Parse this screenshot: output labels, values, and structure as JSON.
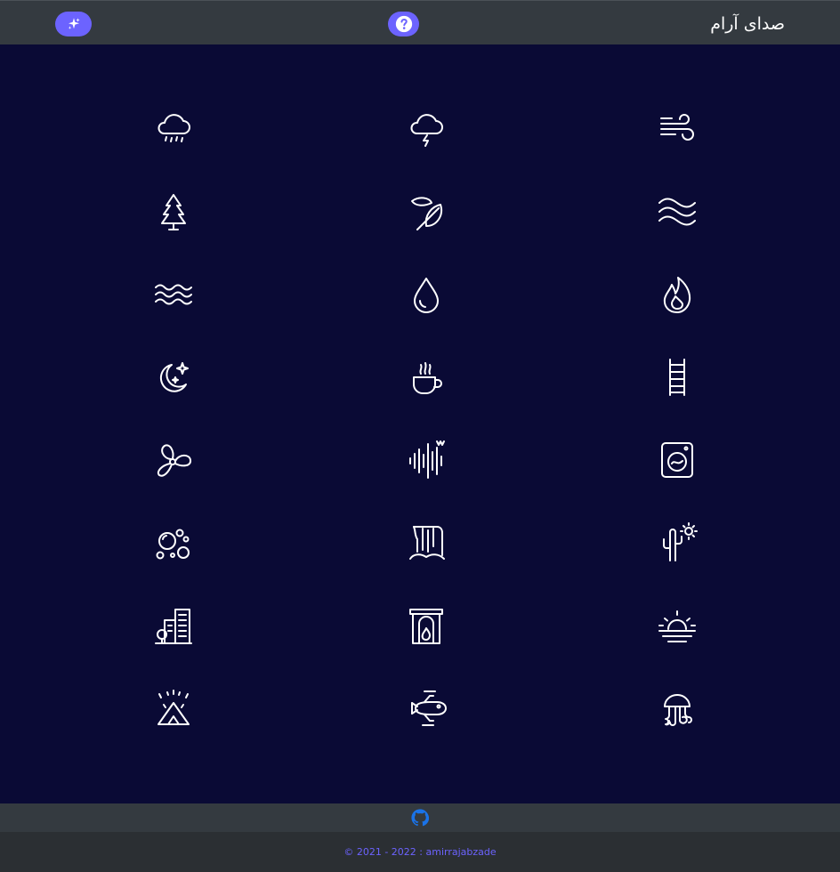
{
  "header": {
    "title": "صدای آرام",
    "theme_button_icon": "sparkles-icon",
    "help_button_icon": "question-circle-icon",
    "accent_color": "#6c63ff",
    "bar_color": "#343a40"
  },
  "sounds": [
    {
      "icon": "rain-cloud-icon"
    },
    {
      "icon": "thunderstorm-icon"
    },
    {
      "icon": "wind-icon"
    },
    {
      "icon": "pine-tree-icon"
    },
    {
      "icon": "leaves-icon"
    },
    {
      "icon": "waves-icon"
    },
    {
      "icon": "sea-waves-icon"
    },
    {
      "icon": "water-drop-icon"
    },
    {
      "icon": "fire-icon"
    },
    {
      "icon": "moon-stars-icon"
    },
    {
      "icon": "coffee-cup-icon"
    },
    {
      "icon": "train-track-icon"
    },
    {
      "icon": "fan-icon"
    },
    {
      "icon": "sound-wave-icon"
    },
    {
      "icon": "washing-machine-icon"
    },
    {
      "icon": "bubbles-icon"
    },
    {
      "icon": "waterfall-icon"
    },
    {
      "icon": "desert-cactus-icon"
    },
    {
      "icon": "city-icon"
    },
    {
      "icon": "fireplace-icon"
    },
    {
      "icon": "sunset-icon"
    },
    {
      "icon": "campfire-tent-icon"
    },
    {
      "icon": "airplane-icon"
    },
    {
      "icon": "jellyfish-icon"
    }
  ],
  "github_bar": {
    "icon": "github-icon",
    "icon_color": "#1a73e8"
  },
  "footer": {
    "copyright": "© 2021 - 2022 : amirrajabzade"
  },
  "colors": {
    "background": "#0a0a35",
    "icon": "#ffffff"
  }
}
